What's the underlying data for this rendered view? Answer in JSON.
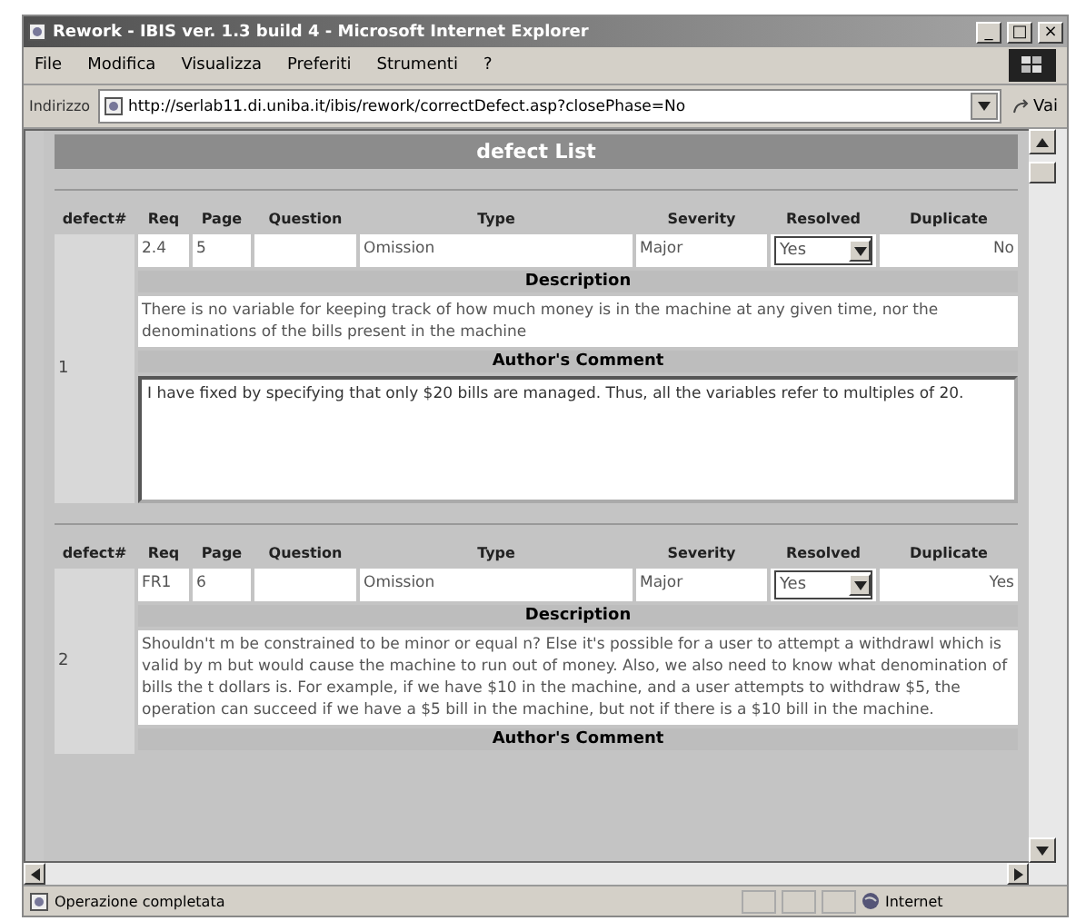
{
  "window": {
    "title": "Rework - IBIS ver. 1.3 build 4 - Microsoft Internet Explorer",
    "controls": [
      "_",
      "□",
      "×"
    ]
  },
  "menu": [
    "File",
    "Modifica",
    "Visualizza",
    "Preferiti",
    "Strumenti",
    "?"
  ],
  "address": {
    "label": "Indirizzo",
    "url": "http://serlab11.di.uniba.it/ibis/rework/correctDefect.asp?closePhase=No",
    "go": "Vai"
  },
  "page_header": "defect List",
  "defects": [
    {
      "columns": [
        "defect#",
        "Req",
        "Page",
        "Question",
        "Type",
        "Severity",
        "Resolved",
        "Duplicate"
      ],
      "number": "1",
      "req": "2.4",
      "page": "5",
      "type": "Omission",
      "severity": "Major",
      "resolved": "Yes",
      "duplicate": "No",
      "description_heading": "Description",
      "description": "There is no variable for keeping track of how much money is in the machine at any given time, nor the denominations of the bills present in the machine",
      "comment_heading": "Author's Comment",
      "comment": "I have fixed by specifying that only $20 bills are managed. Thus, all the variables refer to multiples of 20."
    },
    {
      "columns": [
        "defect#",
        "Req",
        "Page",
        "Question",
        "Type",
        "Severity",
        "Resolved",
        "Duplicate"
      ],
      "number": "2",
      "req": "FR1",
      "page": "6",
      "type": "Omission",
      "severity": "Major",
      "resolved": "Yes",
      "duplicate": "Yes",
      "description_heading": "Description",
      "description": "Shouldn't m be constrained to be minor or equal n? Else it's possible for a user to attempt a withdrawl which is valid by m but would cause the machine to run out of money. Also, we also need to know what denomination of bills the t dollars is. For example, if we have $10 in the machine, and a user attempts to withdraw $5, the operation can succeed if we have a $5 bill in the machine, but not if there is a $10 bill in the machine.",
      "comment_heading": "Author's Comment"
    }
  ],
  "status": {
    "text": "Operazione completata",
    "zone": "Internet"
  }
}
